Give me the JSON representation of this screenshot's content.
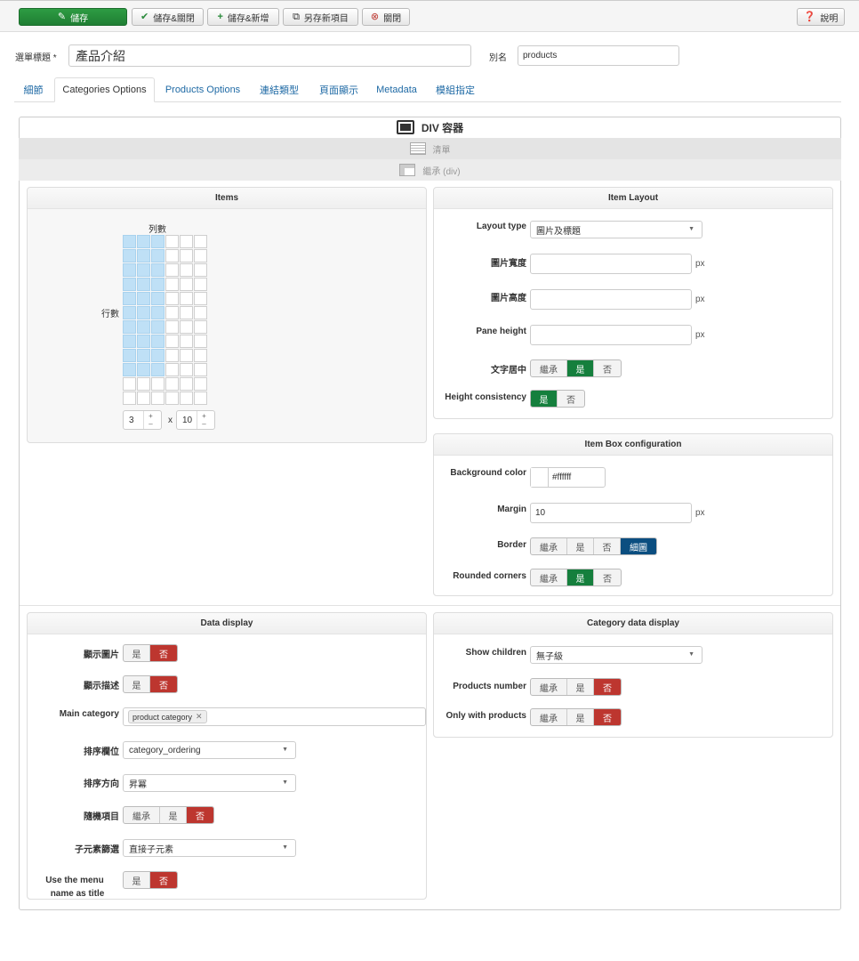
{
  "toolbar": {
    "save": "儲存",
    "save_close": "儲存&關閉",
    "save_new": "儲存&新增",
    "save_copy": "另存新項目",
    "close": "關閉",
    "help": "說明"
  },
  "form": {
    "title_label": "選單標題 *",
    "title_value": "產品介紹",
    "alias_label": "別名",
    "alias_value": "products"
  },
  "tabs": [
    "細節",
    "Categories Options",
    "Products Options",
    "連結類型",
    "頁面顯示",
    "Metadata",
    "模組指定"
  ],
  "bars": {
    "div": "DIV 容器",
    "list": "清單",
    "inherit": "繼承 (div)"
  },
  "items_panel": {
    "title": "Items",
    "cols_label": "列數",
    "rows_label": "行數",
    "cols_value": 3,
    "rows_value": 10,
    "x": "x",
    "plus": "+",
    "minus": "–"
  },
  "item_layout": {
    "title": "Item Layout",
    "layout_type_label": "Layout type",
    "layout_type_value": "圖片及標題",
    "img_width_label": "圖片寬度",
    "img_height_label": "圖片高度",
    "pane_height_label": "Pane height",
    "center_label": "文字居中",
    "height_consistency_label": "Height consistency",
    "px": "px",
    "center_options": [
      "繼承",
      "是",
      "否"
    ],
    "height_options": [
      "是",
      "否"
    ]
  },
  "item_box": {
    "title": "Item Box configuration",
    "bg_label": "Background color",
    "bg_value": "#ffffff",
    "margin_label": "Margin",
    "margin_value": "10",
    "px": "px",
    "border_label": "Border",
    "border_options": [
      "繼承",
      "是",
      "否",
      "細圖"
    ],
    "rounded_label": "Rounded corners",
    "rounded_options": [
      "繼承",
      "是",
      "否"
    ]
  },
  "data_display": {
    "title": "Data display",
    "show_image_label": "顯示圖片",
    "show_desc_label": "顯示描述",
    "yesno": [
      "是",
      "否"
    ],
    "main_category_label": "Main category",
    "main_category_tag": "product category",
    "order_field_label": "排序欄位",
    "order_field_value": "category_ordering",
    "order_dir_label": "排序方向",
    "order_dir_value": "昇冪",
    "random_label": "隨機項目",
    "random_options": [
      "繼承",
      "是",
      "否"
    ],
    "child_filter_label": "子元素篩選",
    "child_filter_value": "直接子元素",
    "menu_title_label_1": "Use the menu",
    "menu_title_label_2": "name as title"
  },
  "category_display": {
    "title": "Category data display",
    "show_children_label": "Show children",
    "show_children_value": "無子級",
    "products_number_label": "Products number",
    "only_products_label": "Only with products",
    "options": [
      "繼承",
      "是",
      "否"
    ]
  }
}
